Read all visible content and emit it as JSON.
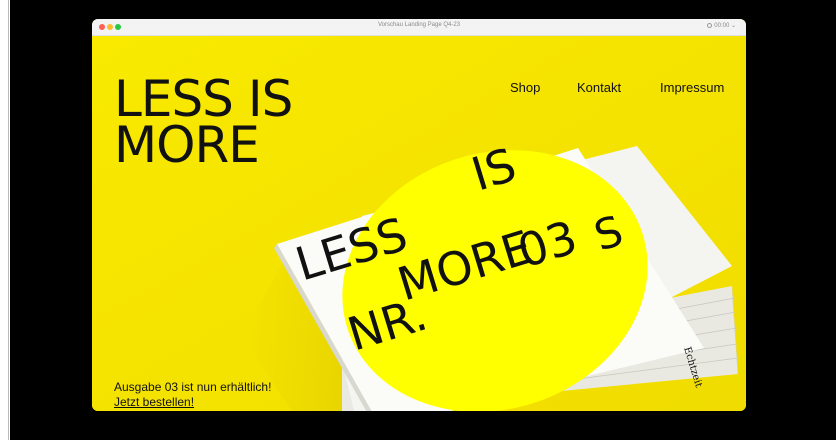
{
  "window": {
    "title": "Vorschau Landing Page Q4-23",
    "time": "00:00"
  },
  "hero": {
    "line1": "LESS IS",
    "line2": "MORE"
  },
  "nav": {
    "items": [
      {
        "label": "Shop"
      },
      {
        "label": "Kontakt"
      },
      {
        "label": "Impressum"
      }
    ]
  },
  "magazine": {
    "cover_line1": "LESS",
    "cover_line2": "IS",
    "cover_line3": "MORE",
    "cover_line4": "03",
    "cover_line5": "NR.",
    "back_text": "S",
    "publisher": "Echtzeit"
  },
  "announcement": {
    "text": "Ausgabe 03 ist nun erhältlich!",
    "cta": "Jetzt bestellen!"
  },
  "colors": {
    "background": "#f7e600",
    "circle": "#ffff00",
    "text": "#111111"
  }
}
